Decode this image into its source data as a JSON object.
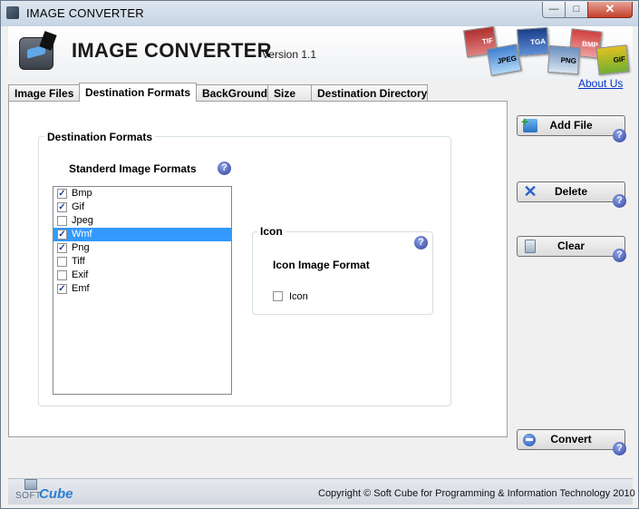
{
  "window": {
    "title": "IMAGE CONVERTER",
    "controls": {
      "minimize": "—",
      "maximize": "□",
      "close": "✕"
    }
  },
  "header": {
    "app_name": "IMAGE CONVERTER",
    "version": "Version 1.1",
    "formats_art": [
      "TIF",
      "TGA",
      "BMP",
      "JPEG",
      "PNG",
      "GIF"
    ],
    "about_link": "About Us"
  },
  "tabs": [
    {
      "label": "Image Files",
      "active": false
    },
    {
      "label": "Destination Formats",
      "active": true
    },
    {
      "label": "BackGround",
      "active": false
    },
    {
      "label": "Size",
      "active": false
    },
    {
      "label": "Destination Directory",
      "active": false
    }
  ],
  "destination": {
    "group_title": "Destination Formats",
    "standard_label": "Standerd Image Formats",
    "help": "?",
    "formats": [
      {
        "label": "Bmp",
        "checked": true,
        "selected": false
      },
      {
        "label": "Gif",
        "checked": true,
        "selected": false
      },
      {
        "label": "Jpeg",
        "checked": false,
        "selected": false
      },
      {
        "label": "Wmf",
        "checked": true,
        "selected": true
      },
      {
        "label": "Png",
        "checked": true,
        "selected": false
      },
      {
        "label": "Tiff",
        "checked": false,
        "selected": false
      },
      {
        "label": "Exif",
        "checked": false,
        "selected": false
      },
      {
        "label": "Emf",
        "checked": true,
        "selected": false
      }
    ],
    "icon_group": {
      "title": "Icon",
      "format_label": "Icon Image Format",
      "checkbox_label": "Icon",
      "checked": false
    }
  },
  "side_buttons": {
    "add_file": "Add File",
    "delete": "Delete",
    "clear": "Clear",
    "convert": "Convert"
  },
  "footer": {
    "brand_soft": "SOFT",
    "brand_cube": "Cube",
    "copyright": "Copyright © Soft Cube for Programming & Information Technology 2010"
  },
  "colors": {
    "accent_blue": "#3399ff",
    "link": "#0033cc",
    "close_red": "#c2412b"
  }
}
